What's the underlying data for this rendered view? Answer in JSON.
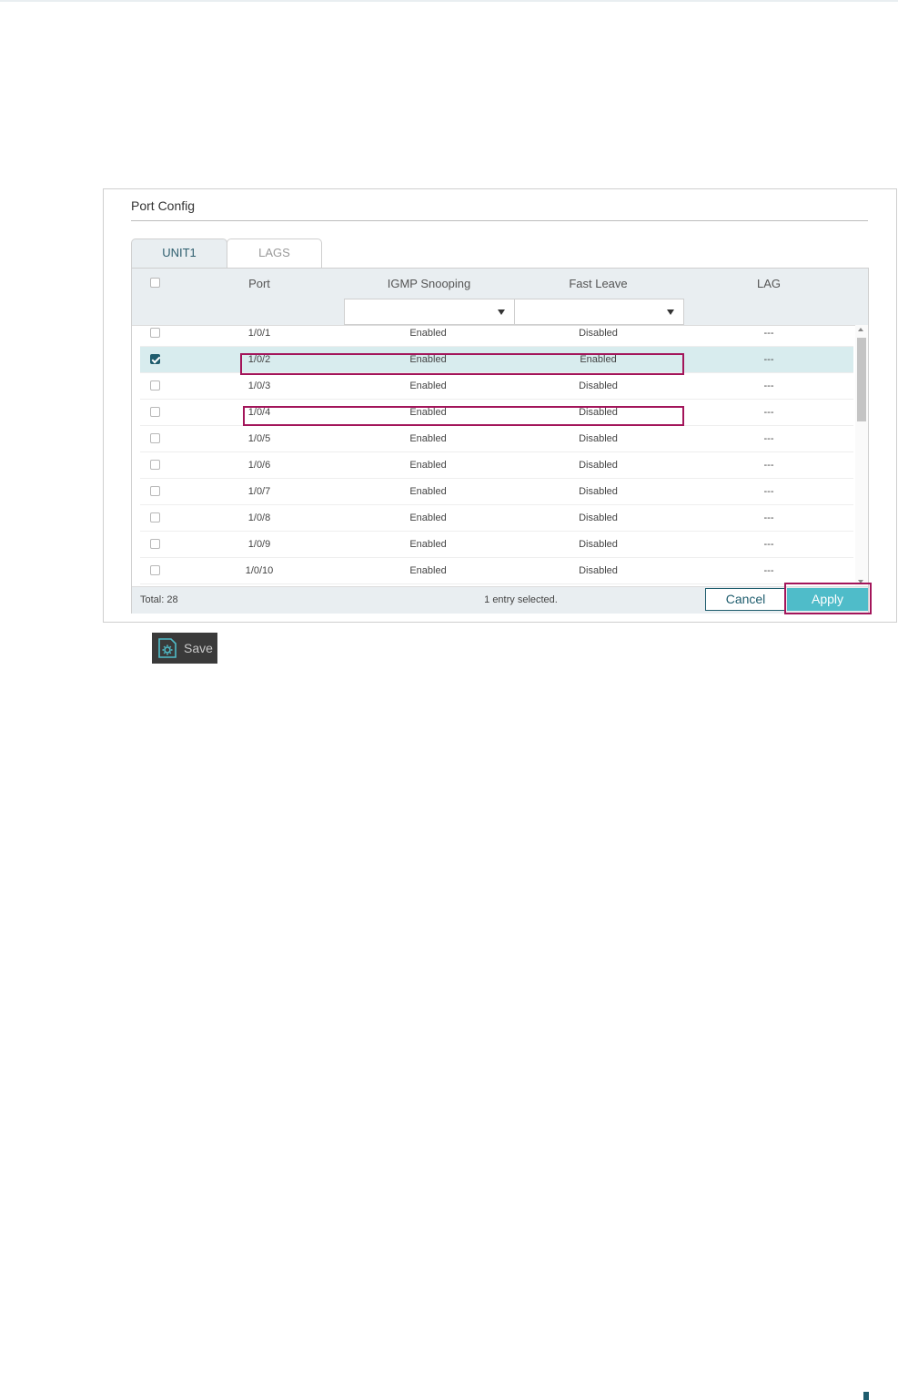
{
  "panel": {
    "title": "Port Config"
  },
  "tabs": [
    {
      "label": "UNIT1",
      "active": true
    },
    {
      "label": "LAGS",
      "active": false
    }
  ],
  "table": {
    "columns": [
      "Port",
      "IGMP Snooping",
      "Fast Leave",
      "LAG"
    ],
    "rows": [
      {
        "port": "1/0/1",
        "igmp_snooping": "Enabled",
        "fast_leave": "Disabled",
        "lag": "---",
        "checked": false
      },
      {
        "port": "1/0/2",
        "igmp_snooping": "Enabled",
        "fast_leave": "Enabled",
        "lag": "---",
        "checked": true
      },
      {
        "port": "1/0/3",
        "igmp_snooping": "Enabled",
        "fast_leave": "Disabled",
        "lag": "---",
        "checked": false
      },
      {
        "port": "1/0/4",
        "igmp_snooping": "Enabled",
        "fast_leave": "Disabled",
        "lag": "---",
        "checked": false
      },
      {
        "port": "1/0/5",
        "igmp_snooping": "Enabled",
        "fast_leave": "Disabled",
        "lag": "---",
        "checked": false
      },
      {
        "port": "1/0/6",
        "igmp_snooping": "Enabled",
        "fast_leave": "Disabled",
        "lag": "---",
        "checked": false
      },
      {
        "port": "1/0/7",
        "igmp_snooping": "Enabled",
        "fast_leave": "Disabled",
        "lag": "---",
        "checked": false
      },
      {
        "port": "1/0/8",
        "igmp_snooping": "Enabled",
        "fast_leave": "Disabled",
        "lag": "---",
        "checked": false
      },
      {
        "port": "1/0/9",
        "igmp_snooping": "Enabled",
        "fast_leave": "Disabled",
        "lag": "---",
        "checked": false
      },
      {
        "port": "1/0/10",
        "igmp_snooping": "Enabled",
        "fast_leave": "Disabled",
        "lag": "---",
        "checked": false
      }
    ]
  },
  "footer": {
    "total": "Total: 28",
    "selection": "1 entry selected."
  },
  "buttons": {
    "cancel": "Cancel",
    "apply": "Apply",
    "save": "Save"
  },
  "colors": {
    "accent": "#4fbcc9",
    "dark_teal": "#1e5c6d",
    "highlight": "#a3155a",
    "header_bg": "#e9eef1",
    "selected_row": "#d8ecee"
  }
}
